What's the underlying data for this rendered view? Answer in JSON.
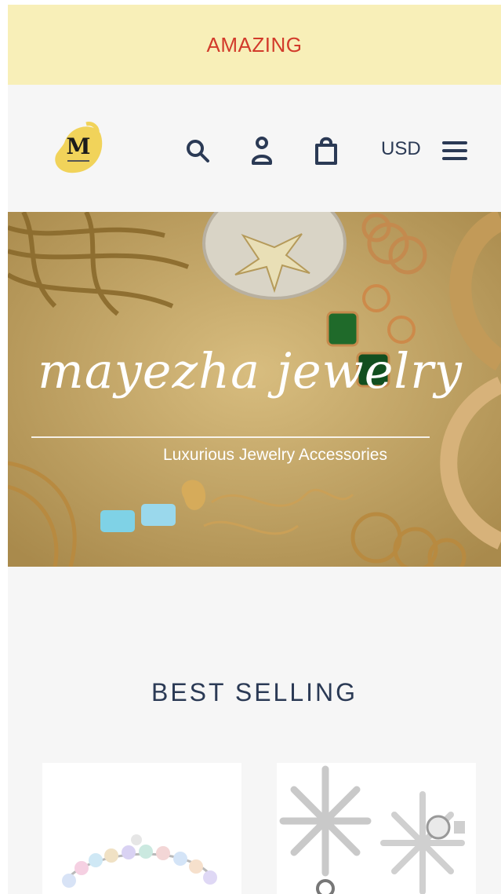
{
  "announcement": {
    "text": "AMAZING"
  },
  "header": {
    "logo_icon": "mayezha-logo",
    "search_icon": "search-icon",
    "account_icon": "account-icon",
    "cart_icon": "cart-icon",
    "currency": "USD",
    "menu_icon": "hamburger-menu-icon"
  },
  "hero": {
    "brand_script": "mayezha jewelry",
    "tagline": "Luxurious Jewelry Accessories"
  },
  "best_selling": {
    "title": "BEST SELLING",
    "products": [
      {
        "image": "crystal-bracelet-image"
      },
      {
        "image": "snowflake-earrings-image"
      }
    ]
  },
  "colors": {
    "announcement_bg": "#f8efb8",
    "announcement_text": "#d23b2b",
    "navy": "#2b3a55",
    "hero_gold": "#c9ad6e"
  }
}
